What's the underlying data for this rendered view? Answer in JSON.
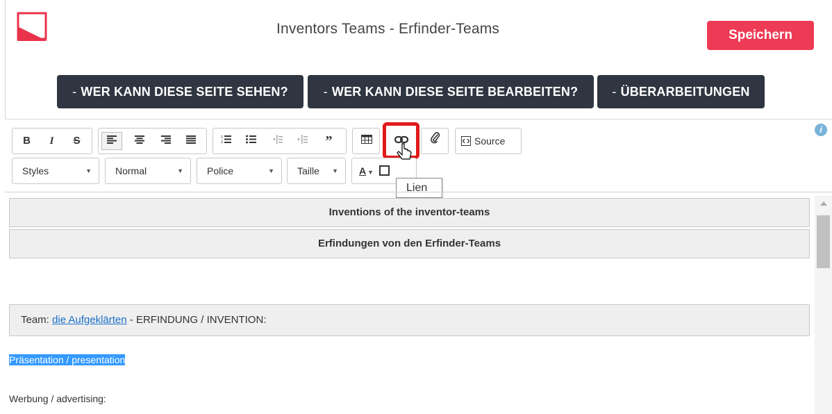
{
  "header": {
    "title": "Inventors Teams - Erfinder-Teams",
    "save_label": "Speichern",
    "brand_color": "#ee3b55"
  },
  "nav": {
    "dash": "-",
    "buttons": [
      {
        "label": "WER KANN DIESE SEITE SEHEN?"
      },
      {
        "label": "WER KANN DIESE SEITE BEARBEITEN?"
      },
      {
        "label": "ÜBERARBEITUNGEN"
      }
    ]
  },
  "toolbar": {
    "bold": "B",
    "italic": "I",
    "strike": "S",
    "source_label": "Source",
    "styles_label": "Styles",
    "format_label": "Normal",
    "font_label": "Police",
    "size_label": "Taille",
    "text_color_label": "A",
    "tooltip": "Lien",
    "highlight_color": "#e11a1a"
  },
  "editor": {
    "header_row_1": "Inventions of the inventor-teams",
    "header_row_2": "Erfindungen von den Erfinder-Teams",
    "team_prefix": "Team:",
    "team_link": "die Aufgeklärten",
    "team_suffix": "- ERFINDUNG / INVENTION:",
    "presentation": "Präsentation / presentation",
    "advertising": "Werbung / advertising:"
  }
}
